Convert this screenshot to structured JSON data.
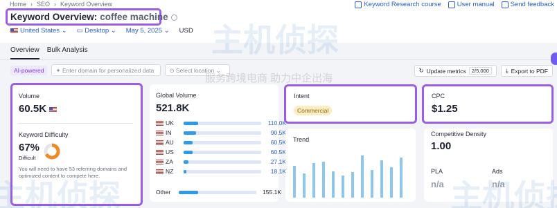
{
  "breadcrumb": [
    "Home",
    "SEO",
    "Keyword Overview"
  ],
  "top_links": [
    "Keyword Research course",
    "User manual",
    "Send feedback"
  ],
  "title": {
    "label": "Keyword Overview:",
    "keyword": "coffee machine"
  },
  "filters": {
    "country": "United States",
    "device": "Desktop",
    "date": "May 5, 2025",
    "currency": "USD"
  },
  "tabs": [
    "Overview",
    "Bulk Analysis"
  ],
  "toolbar": {
    "ai_badge": "AI-powered",
    "domain_placeholder": "Enter domain for personalized data",
    "location_placeholder": "Select location"
  },
  "actions": {
    "update": "Update metrics",
    "update_count": "2/5,000",
    "export": "Export to PDF"
  },
  "volume": {
    "label": "Volume",
    "value": "60.5K"
  },
  "kd": {
    "label": "Keyword Difficulty",
    "value": "67%",
    "level": "Difficult",
    "percent": 67,
    "note": "You will need to have 53 referring domains and optimized content to compete here."
  },
  "global_volume": {
    "label": "Global Volume",
    "value": "521.8K",
    "countries": [
      {
        "code": "UK",
        "value": "110.0K",
        "share": 0.19
      },
      {
        "code": "IN",
        "value": "90.5K",
        "share": 0.16
      },
      {
        "code": "AU",
        "value": "60.5K",
        "share": 0.12
      },
      {
        "code": "US",
        "value": "60.5K",
        "share": 0.12
      },
      {
        "code": "ZA",
        "value": "27.1K",
        "share": 0.06
      },
      {
        "code": "NZ",
        "value": "18.1K",
        "share": 0.04
      }
    ],
    "other": {
      "label": "Other",
      "value": "155.1K",
      "share": 0.25
    }
  },
  "intent": {
    "label": "Intent",
    "value": "Commercial"
  },
  "trend": {
    "label": "Trend",
    "values": [
      0.72,
      0.55,
      0.78,
      0.82,
      0.6,
      0.5,
      0.58,
      0.95,
      0.62,
      0.85,
      0.68,
      0.9
    ]
  },
  "cpc": {
    "label": "CPC",
    "value": "$1.25"
  },
  "density": {
    "label": "Competitive Density",
    "value": "1.00"
  },
  "pla": {
    "label": "PLA",
    "value": "n/a"
  },
  "ads": {
    "label": "Ads",
    "value": "n/a"
  },
  "watermark": {
    "text": "主机侦探",
    "subtext": "服务跨境电商 助力中企出海"
  },
  "colors": {
    "accent": "#9b5de5",
    "link": "#2a5bd7",
    "bar": "#2f9be8",
    "kd_ring": "#f08a24"
  }
}
